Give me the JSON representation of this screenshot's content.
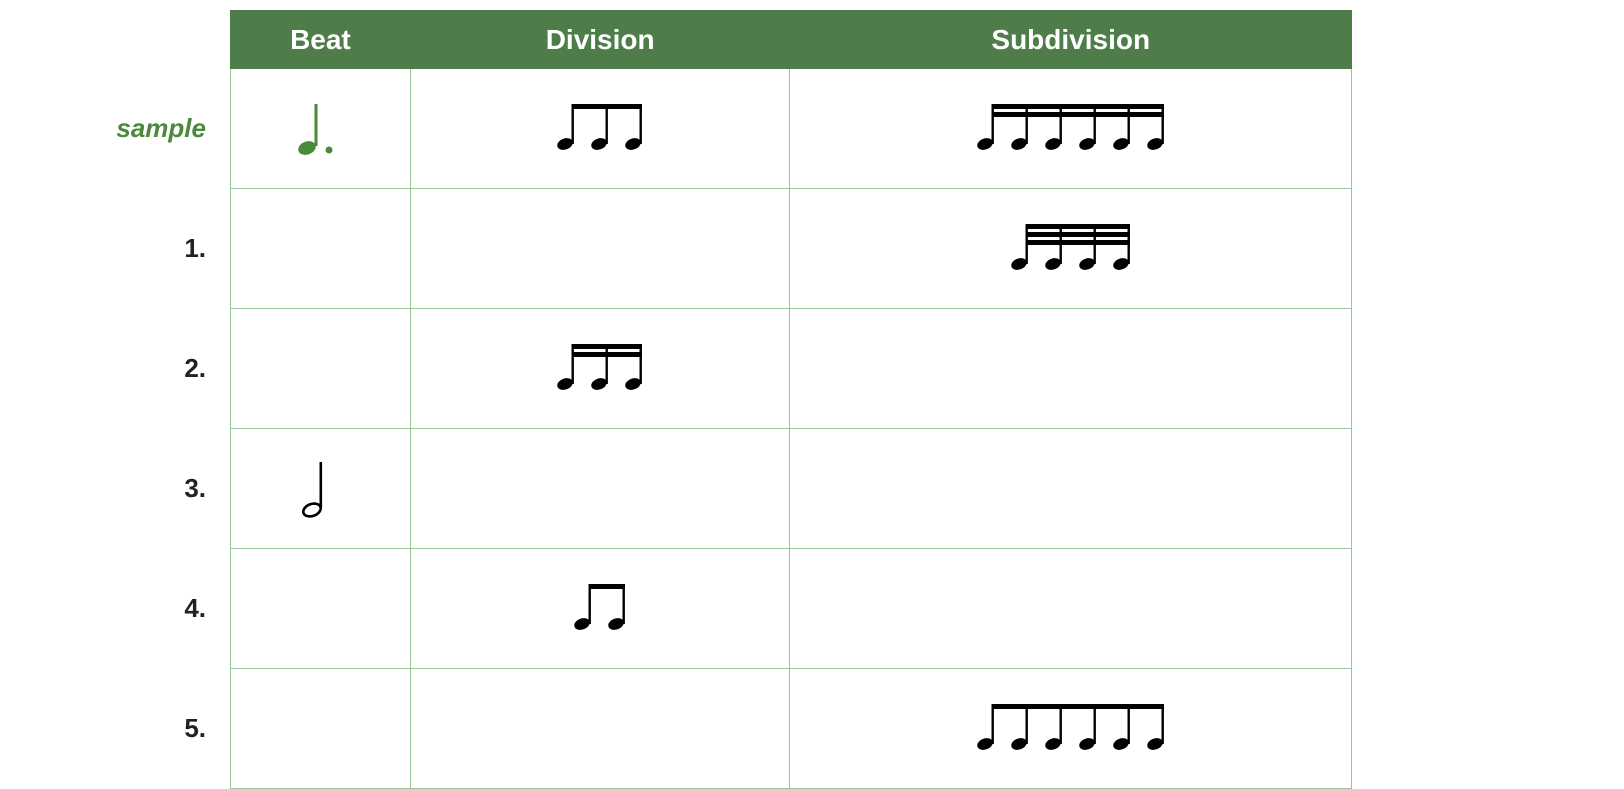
{
  "headers": {
    "beat": "Beat",
    "division": "Division",
    "subdivision": "Subdivision"
  },
  "rowLabels": {
    "sample": "sample",
    "r1": "1.",
    "r2": "2.",
    "r3": "3.",
    "r4": "4.",
    "r5": "5."
  },
  "rows": [
    {
      "id": "sample",
      "beat": {
        "kind": "dotted-quarter",
        "color": "#4a8a3a"
      },
      "division": {
        "kind": "beamed",
        "count": 3,
        "beams": 1,
        "color": "#000"
      },
      "subdivision": {
        "kind": "beamed",
        "count": 6,
        "beams": 2,
        "color": "#000"
      }
    },
    {
      "id": "r1",
      "beat": null,
      "division": null,
      "subdivision": {
        "kind": "beamed",
        "count": 4,
        "beams": 3,
        "color": "#000"
      }
    },
    {
      "id": "r2",
      "beat": null,
      "division": {
        "kind": "beamed",
        "count": 3,
        "beams": 2,
        "color": "#000"
      },
      "subdivision": null
    },
    {
      "id": "r3",
      "beat": {
        "kind": "half",
        "color": "#000"
      },
      "division": null,
      "subdivision": null
    },
    {
      "id": "r4",
      "beat": null,
      "division": {
        "kind": "beamed",
        "count": 2,
        "beams": 1,
        "color": "#000"
      },
      "subdivision": null
    },
    {
      "id": "r5",
      "beat": null,
      "division": null,
      "subdivision": {
        "kind": "beamed",
        "count": 6,
        "beams": 1,
        "color": "#000"
      }
    }
  ]
}
